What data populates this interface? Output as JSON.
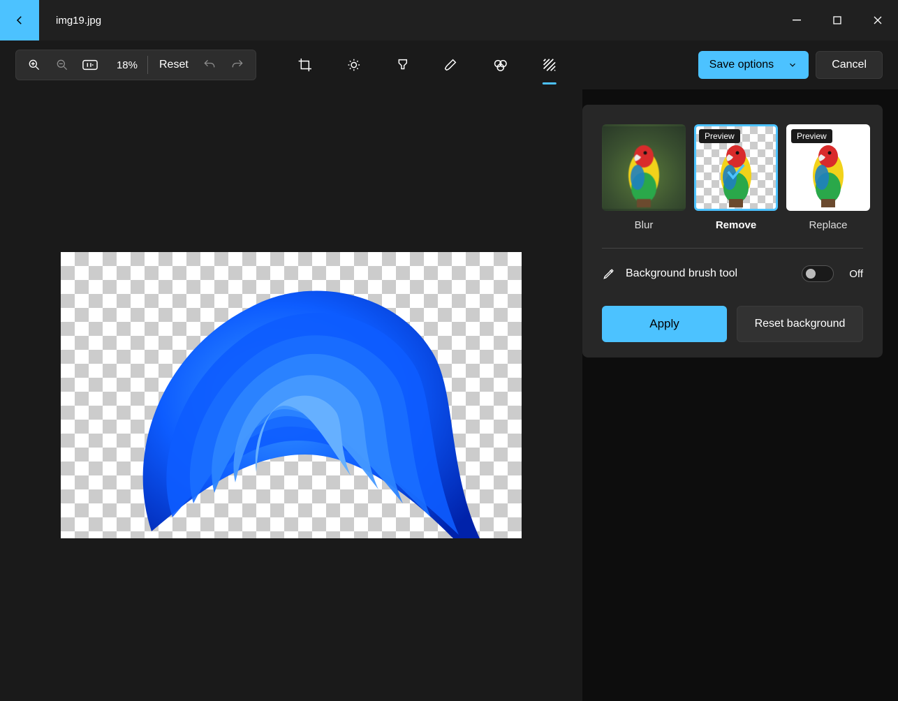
{
  "titlebar": {
    "filename": "img19.jpg"
  },
  "toolbar": {
    "zoom_percent": "18%",
    "reset_label": "Reset",
    "save_label": "Save options",
    "cancel_label": "Cancel",
    "tools": {
      "crop": "crop-icon",
      "adjust": "adjust-icon",
      "filter": "filter-icon",
      "markup": "markup-icon",
      "erase": "erase-icon",
      "background": "background-icon"
    }
  },
  "panel": {
    "thumbs": {
      "blur_label": "Blur",
      "remove_label": "Remove",
      "replace_label": "Replace",
      "preview_badge": "Preview"
    },
    "brush_label": "Background brush tool",
    "toggle_state": "Off",
    "apply_label": "Apply",
    "reset_bg_label": "Reset background"
  },
  "colors": {
    "accent": "#4cc2ff"
  }
}
